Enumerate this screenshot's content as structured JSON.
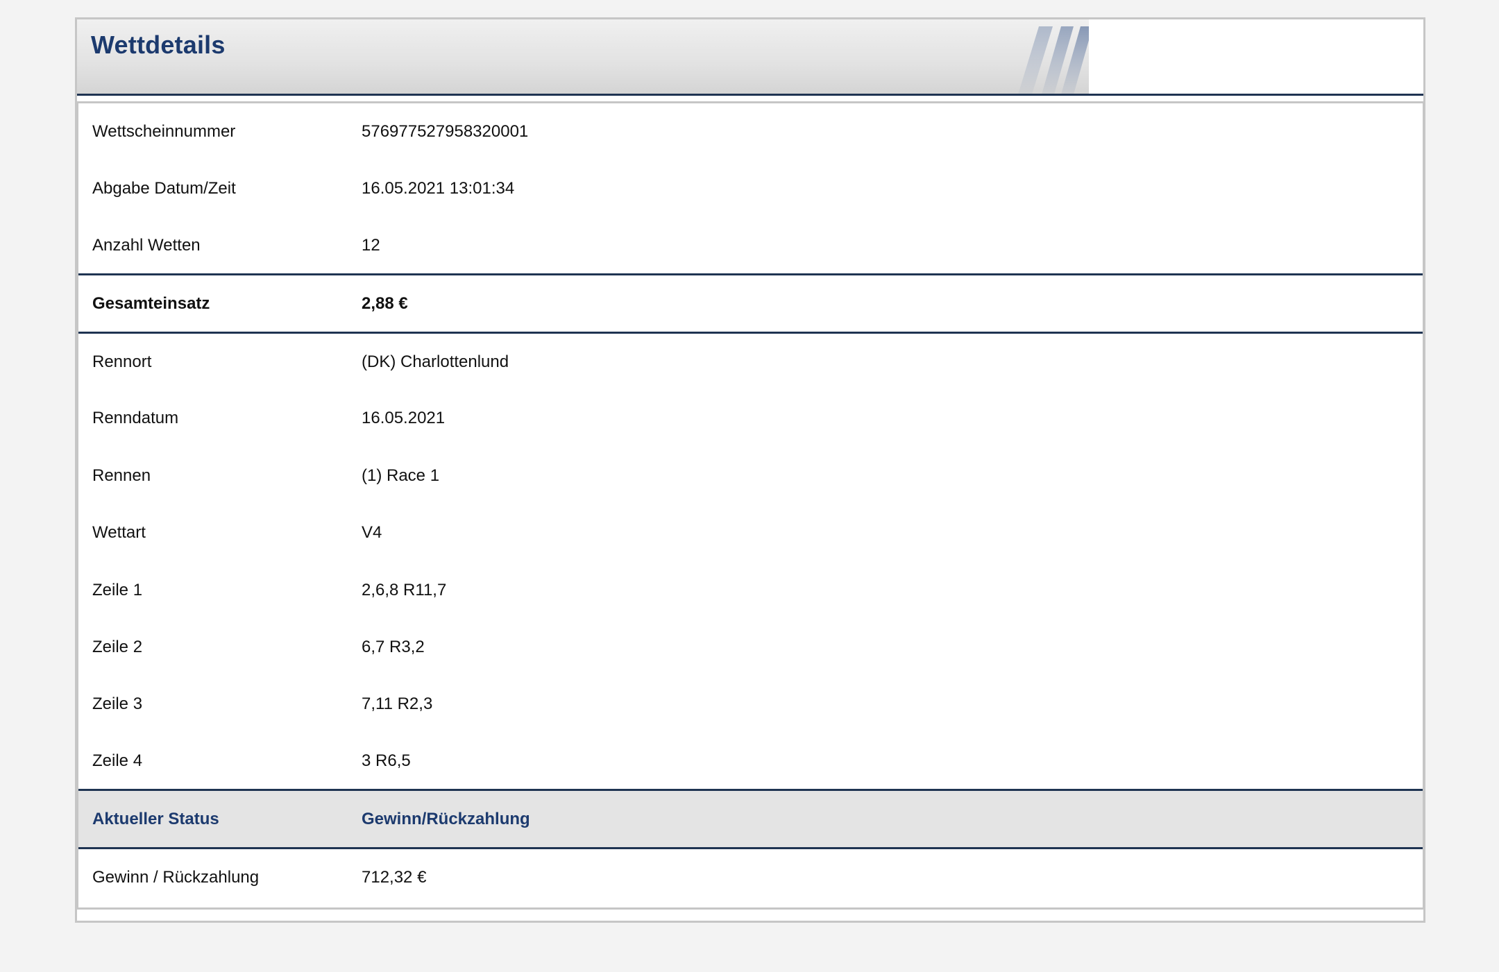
{
  "header": {
    "title": "Wettdetails"
  },
  "ticket": {
    "rows": [
      {
        "label": "Wettscheinnummer",
        "value": "576977527958320001"
      },
      {
        "label": "Abgabe Datum/Zeit",
        "value": "16.05.2021 13:01:34"
      },
      {
        "label": "Anzahl Wetten",
        "value": "12"
      }
    ],
    "total": {
      "label": "Gesamteinsatz",
      "value": "2,88 €"
    }
  },
  "race": {
    "rows": [
      {
        "label": "Rennort",
        "value": "(DK) Charlottenlund"
      },
      {
        "label": "Renndatum",
        "value": "16.05.2021"
      },
      {
        "label": "Rennen",
        "value": "(1) Race 1"
      },
      {
        "label": "Wettart",
        "value": "V4"
      },
      {
        "label": "Zeile 1",
        "value": "2,6,8 R11,7"
      },
      {
        "label": "Zeile 2",
        "value": "6,7 R3,2"
      },
      {
        "label": "Zeile 3",
        "value": "7,11 R2,3"
      },
      {
        "label": "Zeile 4",
        "value": "3 R6,5"
      }
    ]
  },
  "status": {
    "header_label": "Aktueller Status",
    "header_value": "Gewinn/Rückzahlung",
    "row": {
      "label": "Gewinn / Rückzahlung",
      "value": "712,32 €"
    }
  },
  "colors": {
    "title": "#1c3a6e",
    "rule": "#1f3452",
    "status_bg": "#e4e4e4",
    "page_bg": "#f3f3f3"
  }
}
